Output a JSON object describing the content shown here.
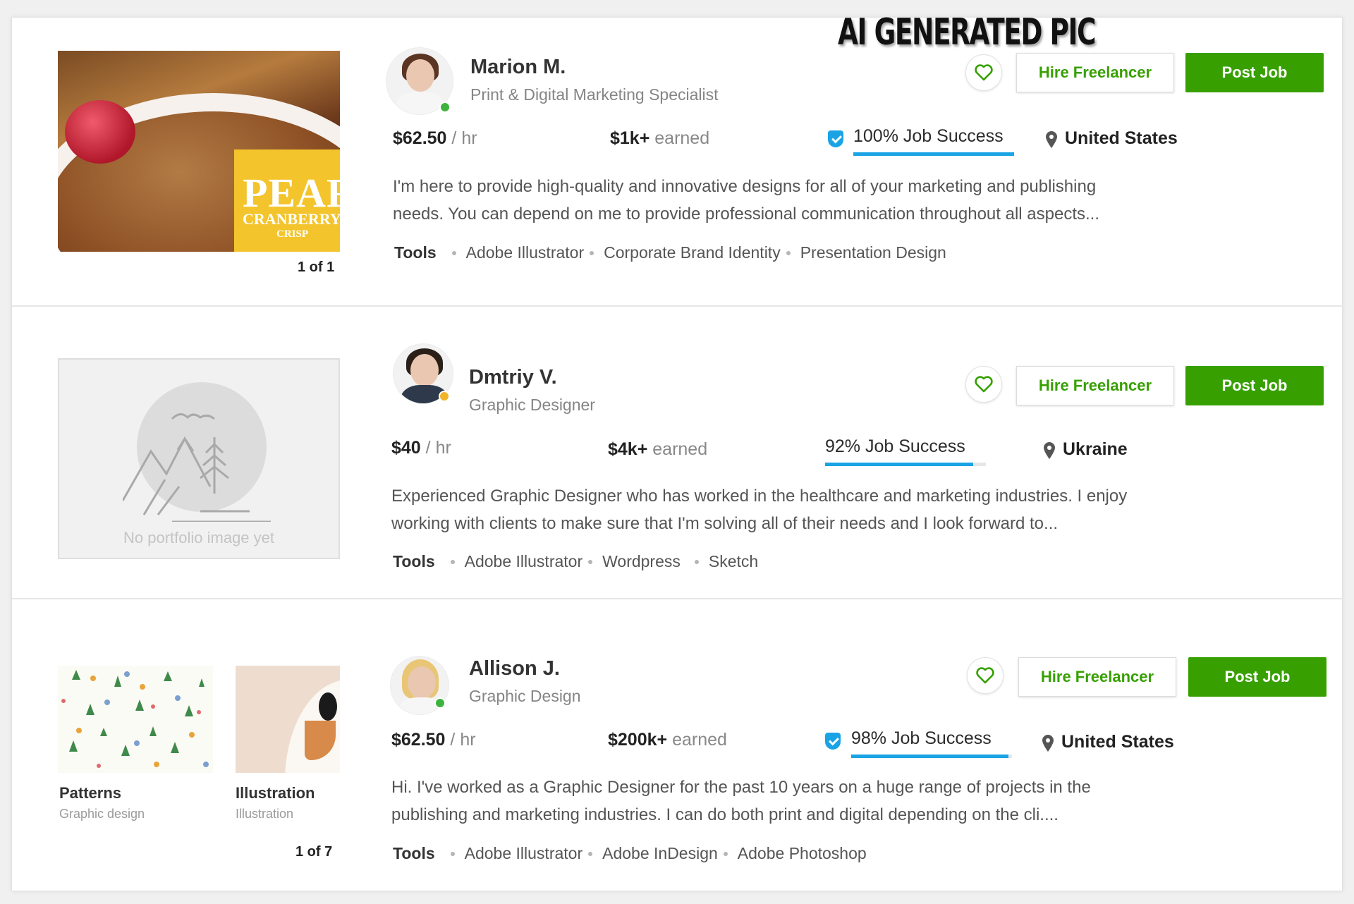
{
  "watermark": "AI GENERATED PIC",
  "colors": {
    "accent_green": "#37a000",
    "job_success_blue": "#1aa3e5",
    "online": "#3db33d",
    "away": "#f0b429"
  },
  "freelancers": [
    {
      "name": "Marion M.",
      "title": "Print & Digital Marketing Specialist",
      "rate": "$62.50",
      "rate_unit": "/ hr",
      "earned": "$1k+",
      "earned_label": "earned",
      "job_success": "100% Job Success",
      "job_success_pct": 100,
      "location": "United States",
      "description_line1": "I'm here to provide high-quality and innovative designs for all of your marketing and publishing",
      "description_line2": "needs. You can depend on me to provide professional communication throughout all aspects...",
      "tools_label": "Tools",
      "tools": [
        "Adobe Illustrator",
        "Corporate Brand Identity",
        "Presentation Design"
      ],
      "portfolio_counter": "1 of 1",
      "portfolio_image_text": {
        "big": "PEAR",
        "mid": "CRANBERRY",
        "small": "CRISP"
      }
    },
    {
      "name": "Dmtriy V.",
      "title": "Graphic Designer",
      "rate": "$40",
      "rate_unit": "/ hr",
      "earned": "$4k+",
      "earned_label": "earned",
      "job_success": "92% Job Success",
      "job_success_pct": 92,
      "location": "Ukraine",
      "description_line1": "Experienced Graphic Designer who has worked in the healthcare and marketing industries. I enjoy",
      "description_line2": "working with clients to make sure that I'm solving all of their needs and I look forward to...",
      "tools_label": "Tools",
      "tools": [
        "Adobe Illustrator",
        "Wordpress",
        "Sketch"
      ],
      "no_portfolio": "No portfolio image yet"
    },
    {
      "name": "Allison J.",
      "title": "Graphic Design",
      "rate": "$62.50",
      "rate_unit": "/ hr",
      "earned": "$200k+",
      "earned_label": "earned",
      "job_success": "98% Job Success",
      "job_success_pct": 98,
      "location": "United States",
      "description_line1": "Hi. I've worked as a Graphic Designer for the past 10 years on a huge range of projects in the",
      "description_line2": "publishing and marketing industries. I can do both print and digital depending on the cli....",
      "tools_label": "Tools",
      "tools": [
        "Adobe Illustrator",
        "Adobe InDesign",
        "Adobe Photoshop"
      ],
      "portfolio_counter": "1 of 7",
      "portfolio_items": [
        {
          "title": "Patterns",
          "subtitle": "Graphic design"
        },
        {
          "title": "Illustration",
          "subtitle": "Illustration"
        }
      ]
    }
  ],
  "actions": {
    "hire_label": "Hire Freelancer",
    "post_label": "Post Job",
    "favorite_icon": "heart-icon"
  },
  "icons": {
    "location": "map-pin-icon",
    "shield": "shield-check-icon"
  }
}
